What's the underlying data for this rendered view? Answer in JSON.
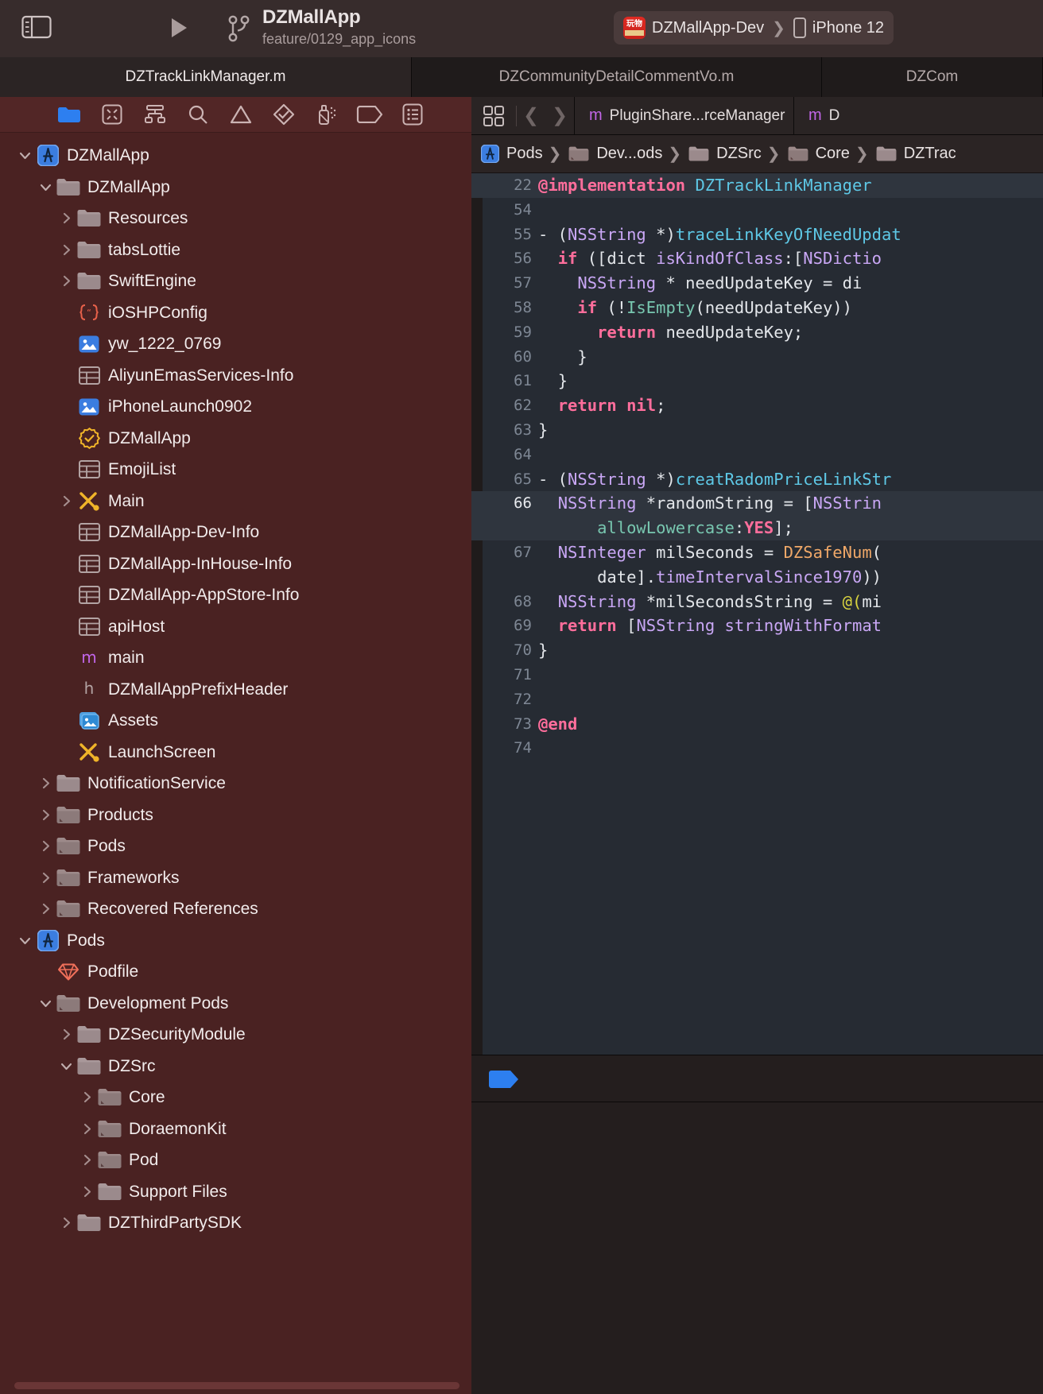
{
  "titlebar": {
    "sidebar_toggle_icon": "sidebar-toggle-icon",
    "run_icon": "run-play-icon",
    "branch_icon": "git-branch-icon",
    "project_name": "DZMallApp",
    "branch_name": "feature/0129_app_icons",
    "scheme": {
      "app_icon_text": "玩物",
      "app_icon_sub": "潮流好物",
      "scheme_name": "DZMallApp-Dev",
      "separator": "❯",
      "device_name": "iPhone 12"
    }
  },
  "tabs": [
    {
      "label": "DZTrackLinkManager.m",
      "active": true
    },
    {
      "label": "DZCommunityDetailCommentVo.m",
      "active": false
    },
    {
      "label": "DZCom",
      "active": false
    }
  ],
  "navigator": {
    "toolbar_icons": [
      "folder-icon",
      "source-control-icon",
      "symbol-hierarchy-icon",
      "search-icon",
      "warning-triangle-icon",
      "test-diamond-icon",
      "debug-spray-icon",
      "breakpoint-tag-icon",
      "report-list-icon"
    ],
    "tree": [
      {
        "label": "DZMallApp",
        "indent": 0,
        "twisty": "down",
        "icon": "xcode-project-icon"
      },
      {
        "label": "DZMallApp",
        "indent": 1,
        "twisty": "down",
        "icon": "folder-icon"
      },
      {
        "label": "Resources",
        "indent": 2,
        "twisty": "right",
        "icon": "folder-icon"
      },
      {
        "label": "tabsLottie",
        "indent": 2,
        "twisty": "right",
        "icon": "folder-icon"
      },
      {
        "label": "SwiftEngine",
        "indent": 2,
        "twisty": "right",
        "icon": "folder-icon"
      },
      {
        "label": "iOSHPConfig",
        "indent": 2,
        "twisty": "none",
        "icon": "json-braces-icon"
      },
      {
        "label": "yw_1222_0769",
        "indent": 2,
        "twisty": "none",
        "icon": "image-icon"
      },
      {
        "label": "AliyunEmasServices-Info",
        "indent": 2,
        "twisty": "none",
        "icon": "plist-icon"
      },
      {
        "label": "iPhoneLaunch0902",
        "indent": 2,
        "twisty": "none",
        "icon": "image-icon"
      },
      {
        "label": "DZMallApp",
        "indent": 2,
        "twisty": "none",
        "icon": "entitlements-icon"
      },
      {
        "label": "EmojiList",
        "indent": 2,
        "twisty": "none",
        "icon": "plist-icon"
      },
      {
        "label": "Main",
        "indent": 2,
        "twisty": "right",
        "icon": "storyboard-icon"
      },
      {
        "label": "DZMallApp-Dev-Info",
        "indent": 2,
        "twisty": "none",
        "icon": "plist-icon"
      },
      {
        "label": "DZMallApp-InHouse-Info",
        "indent": 2,
        "twisty": "none",
        "icon": "plist-icon"
      },
      {
        "label": "DZMallApp-AppStore-Info",
        "indent": 2,
        "twisty": "none",
        "icon": "plist-icon"
      },
      {
        "label": "apiHost",
        "indent": 2,
        "twisty": "none",
        "icon": "plist-icon"
      },
      {
        "label": "main",
        "indent": 2,
        "twisty": "none",
        "icon": "objc-m-icon"
      },
      {
        "label": "DZMallAppPrefixHeader",
        "indent": 2,
        "twisty": "none",
        "icon": "header-h-icon"
      },
      {
        "label": "Assets",
        "indent": 2,
        "twisty": "none",
        "icon": "assets-catalog-icon"
      },
      {
        "label": "LaunchScreen",
        "indent": 2,
        "twisty": "none",
        "icon": "storyboard-icon"
      },
      {
        "label": "NotificationService",
        "indent": 1,
        "twisty": "right",
        "icon": "folder-icon"
      },
      {
        "label": "Products",
        "indent": 1,
        "twisty": "right",
        "icon": "folder-group-icon"
      },
      {
        "label": "Pods",
        "indent": 1,
        "twisty": "right",
        "icon": "folder-group-icon"
      },
      {
        "label": "Frameworks",
        "indent": 1,
        "twisty": "right",
        "icon": "folder-group-icon"
      },
      {
        "label": "Recovered References",
        "indent": 1,
        "twisty": "right",
        "icon": "folder-group-icon"
      },
      {
        "label": "Pods",
        "indent": 0,
        "twisty": "down",
        "icon": "xcode-project-icon"
      },
      {
        "label": "Podfile",
        "indent": 1,
        "twisty": "none",
        "icon": "ruby-gem-icon"
      },
      {
        "label": "Development Pods",
        "indent": 1,
        "twisty": "down",
        "icon": "folder-group-icon"
      },
      {
        "label": "DZSecurityModule",
        "indent": 2,
        "twisty": "right",
        "icon": "folder-icon"
      },
      {
        "label": "DZSrc",
        "indent": 2,
        "twisty": "down",
        "icon": "folder-icon"
      },
      {
        "label": "Core",
        "indent": 3,
        "twisty": "right",
        "icon": "folder-group-icon"
      },
      {
        "label": "DoraemonKit",
        "indent": 3,
        "twisty": "right",
        "icon": "folder-group-icon"
      },
      {
        "label": "Pod",
        "indent": 3,
        "twisty": "right",
        "icon": "folder-group-icon"
      },
      {
        "label": "Support Files",
        "indent": 3,
        "twisty": "right",
        "icon": "folder-icon"
      },
      {
        "label": "DZThirdPartySDK",
        "indent": 2,
        "twisty": "right",
        "icon": "folder-icon"
      }
    ]
  },
  "editor": {
    "jump_bar": {
      "grid_icon": "related-items-grid-icon",
      "back_icon": "chevron-left-icon",
      "forward_icon": "chevron-right-icon",
      "open_files": [
        {
          "kind": "m",
          "label": "PluginShare...rceManager"
        },
        {
          "kind": "m",
          "label": "D"
        }
      ]
    },
    "breadcrumb": [
      {
        "icon": "xcode-project-icon",
        "label": "Pods"
      },
      {
        "icon": "folder-group-icon",
        "label": "Dev...ods"
      },
      {
        "icon": "folder-icon",
        "label": "DZSrc"
      },
      {
        "icon": "folder-group-icon",
        "label": "Core"
      },
      {
        "icon": "folder-icon",
        "label": "DZTrac"
      }
    ],
    "sticky_line": {
      "num": "22",
      "tokens": [
        {
          "t": "@implementation ",
          "c": "k"
        },
        {
          "t": "DZTrackLinkManager",
          "c": "cl"
        }
      ]
    },
    "lines": [
      {
        "num": "54",
        "tokens": []
      },
      {
        "num": "55",
        "indent": 0,
        "tokens": [
          {
            "t": "- (",
            "c": "pl"
          },
          {
            "t": "NSString",
            "c": "ty"
          },
          {
            "t": " *)",
            "c": "pl"
          },
          {
            "t": "traceLinkKeyOfNeedUpdat",
            "c": "fn"
          }
        ]
      },
      {
        "num": "56",
        "indent": 2,
        "tokens": [
          {
            "t": "if ",
            "c": "k"
          },
          {
            "t": "([dict ",
            "c": "pl"
          },
          {
            "t": "isKindOfClass",
            "c": "ty"
          },
          {
            "t": ":[",
            "c": "pl"
          },
          {
            "t": "NSDictio",
            "c": "ty"
          }
        ]
      },
      {
        "num": "57",
        "indent": 4,
        "tokens": [
          {
            "t": "NSString",
            "c": "ty"
          },
          {
            "t": " * needUpdateKey = di",
            "c": "pl"
          }
        ]
      },
      {
        "num": "58",
        "indent": 4,
        "tokens": [
          {
            "t": "if ",
            "c": "k"
          },
          {
            "t": "(!",
            "c": "pl"
          },
          {
            "t": "IsEmpty",
            "c": "st"
          },
          {
            "t": "(needUpdateKey))",
            "c": "pl"
          }
        ]
      },
      {
        "num": "59",
        "indent": 6,
        "tokens": [
          {
            "t": "return",
            "c": "k"
          },
          {
            "t": " needUpdateKey;",
            "c": "pl"
          }
        ]
      },
      {
        "num": "60",
        "indent": 4,
        "tokens": [
          {
            "t": "}",
            "c": "pl"
          }
        ]
      },
      {
        "num": "61",
        "indent": 2,
        "tokens": [
          {
            "t": "}",
            "c": "pl"
          }
        ]
      },
      {
        "num": "62",
        "indent": 2,
        "tokens": [
          {
            "t": "return nil",
            "c": "k"
          },
          {
            "t": ";",
            "c": "pl"
          }
        ]
      },
      {
        "num": "63",
        "indent": 0,
        "tokens": [
          {
            "t": "}",
            "c": "pl"
          }
        ]
      },
      {
        "num": "64",
        "tokens": []
      },
      {
        "num": "65",
        "indent": 0,
        "tokens": [
          {
            "t": "- (",
            "c": "pl"
          },
          {
            "t": "NSString",
            "c": "ty"
          },
          {
            "t": " *)",
            "c": "pl"
          },
          {
            "t": "creatRadomPriceLinkStr",
            "c": "fn"
          }
        ]
      },
      {
        "num": "66",
        "indent": 2,
        "highlight": true,
        "tokens": [
          {
            "t": "NSString",
            "c": "ty"
          },
          {
            "t": " *randomString = [",
            "c": "pl"
          },
          {
            "t": "NSStrin",
            "c": "ty"
          }
        ]
      },
      {
        "num": "",
        "indent": 6,
        "highlight": true,
        "tokens": [
          {
            "t": "allowLowercase",
            "c": "st"
          },
          {
            "t": ":",
            "c": "pl"
          },
          {
            "t": "YES",
            "c": "k"
          },
          {
            "t": "];",
            "c": "pl"
          }
        ]
      },
      {
        "num": "67",
        "indent": 2,
        "tokens": [
          {
            "t": "NSInteger",
            "c": "ty"
          },
          {
            "t": " milSeconds = ",
            "c": "pl"
          },
          {
            "t": "DZSafeNum",
            "c": "mc"
          },
          {
            "t": "(",
            "c": "pl"
          }
        ]
      },
      {
        "num": "",
        "indent": 6,
        "tokens": [
          {
            "t": "date].",
            "c": "pl"
          },
          {
            "t": "timeIntervalSince1970",
            "c": "ty"
          },
          {
            "t": "))",
            "c": "pl"
          }
        ]
      },
      {
        "num": "68",
        "indent": 2,
        "tokens": [
          {
            "t": "NSString",
            "c": "ty"
          },
          {
            "t": " *milSecondsString = ",
            "c": "pl"
          },
          {
            "t": "@(",
            "c": "nm"
          },
          {
            "t": "mi",
            "c": "pl"
          }
        ]
      },
      {
        "num": "69",
        "indent": 2,
        "tokens": [
          {
            "t": "return",
            "c": "k"
          },
          {
            "t": " [",
            "c": "pl"
          },
          {
            "t": "NSString",
            "c": "ty"
          },
          {
            "t": " ",
            "c": "pl"
          },
          {
            "t": "stringWithFormat",
            "c": "ty"
          }
        ]
      },
      {
        "num": "70",
        "indent": 0,
        "tokens": [
          {
            "t": "}",
            "c": "pl"
          }
        ]
      },
      {
        "num": "71",
        "tokens": []
      },
      {
        "num": "72",
        "tokens": []
      },
      {
        "num": "73",
        "indent": 0,
        "tokens": [
          {
            "t": "@end",
            "c": "k"
          }
        ]
      },
      {
        "num": "74",
        "tokens": []
      }
    ],
    "console": {
      "tag_icon": "breakpoint-tag-icon"
    }
  },
  "colors": {
    "navigator_bg": "#4a2222",
    "titlebar_bg": "#372c2c",
    "editor_bg": "#262b33",
    "accent_blue": "#2d7ff0",
    "keyword_pink": "#ff6e9c",
    "type_purple": "#c9a7f5",
    "method_cyan": "#5ec8e6",
    "selector_green": "#78c7b0",
    "macro_orange": "#f0a868"
  }
}
